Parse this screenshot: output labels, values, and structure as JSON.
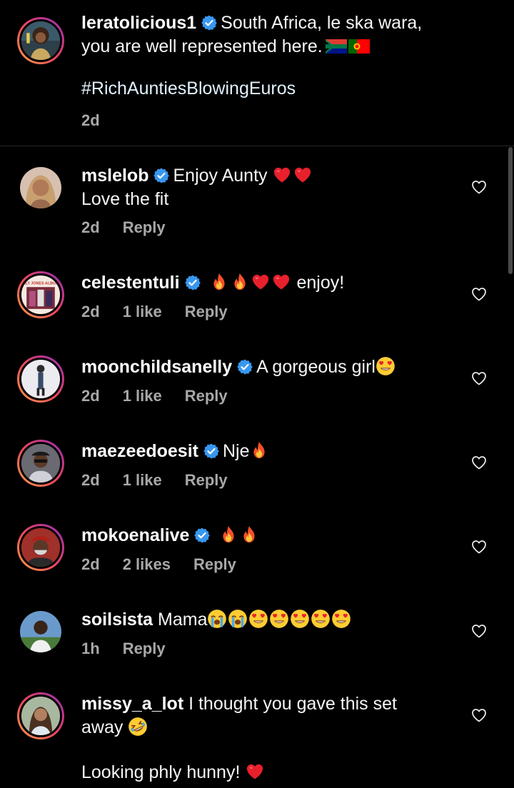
{
  "caption": {
    "username": "leratolicious1",
    "text_line1": "South Africa, le ska wara,",
    "text_line2": "you are well represented here.",
    "hashtag": "#RichAuntiesBlowingEuros",
    "time": "2d",
    "verified": true,
    "flags": [
      "south-africa-flag",
      "portugal-flag"
    ]
  },
  "comments": [
    {
      "username": "mslelob",
      "verified": true,
      "text": "Enjoy Aunty",
      "emojis_after": [
        "red-heart",
        "red-heart"
      ],
      "text_line2": "Love the fit",
      "time": "2d",
      "likes": "",
      "reply": "Reply"
    },
    {
      "username": "celestentuli",
      "verified": true,
      "emojis_before": [
        "fire",
        "fire",
        "red-heart",
        "red-heart"
      ],
      "text": "enjoy!",
      "time": "2d",
      "likes": "1 like",
      "reply": "Reply",
      "avatar_text": "ALY JONES ALBUM"
    },
    {
      "username": "moonchildsanelly",
      "verified": true,
      "text": "A gorgeous girl",
      "emojis_after": [
        "heart-eyes"
      ],
      "time": "2d",
      "likes": "1 like",
      "reply": "Reply"
    },
    {
      "username": "maezeedoesit",
      "verified": true,
      "text": "Nje",
      "emojis_after": [
        "fire"
      ],
      "time": "2d",
      "likes": "1 like",
      "reply": "Reply"
    },
    {
      "username": "mokoenalive",
      "verified": true,
      "text": "",
      "emojis_after": [
        "fire",
        "fire"
      ],
      "time": "2d",
      "likes": "2 likes",
      "reply": "Reply"
    },
    {
      "username": "soilsista",
      "verified": false,
      "text": "Mama",
      "emojis_after": [
        "crying",
        "crying",
        "heart-eyes",
        "heart-eyes",
        "heart-eyes",
        "heart-eyes",
        "heart-eyes"
      ],
      "time": "1h",
      "likes": "",
      "reply": "Reply"
    },
    {
      "username": "missy_a_lot",
      "verified": false,
      "text": "I thought you gave this set",
      "text_line2": "away",
      "emojis_line2": [
        "rolling-laughing"
      ],
      "text_line3": "Looking phly hunny!",
      "emojis_line3": [
        "red-heart"
      ],
      "time": "",
      "likes": "",
      "reply": ""
    }
  ],
  "colors": {
    "background": "#000000",
    "text": "#f5f5f5",
    "meta": "#a8a8a8",
    "verified": "#3897f0",
    "divider": "#262626"
  }
}
